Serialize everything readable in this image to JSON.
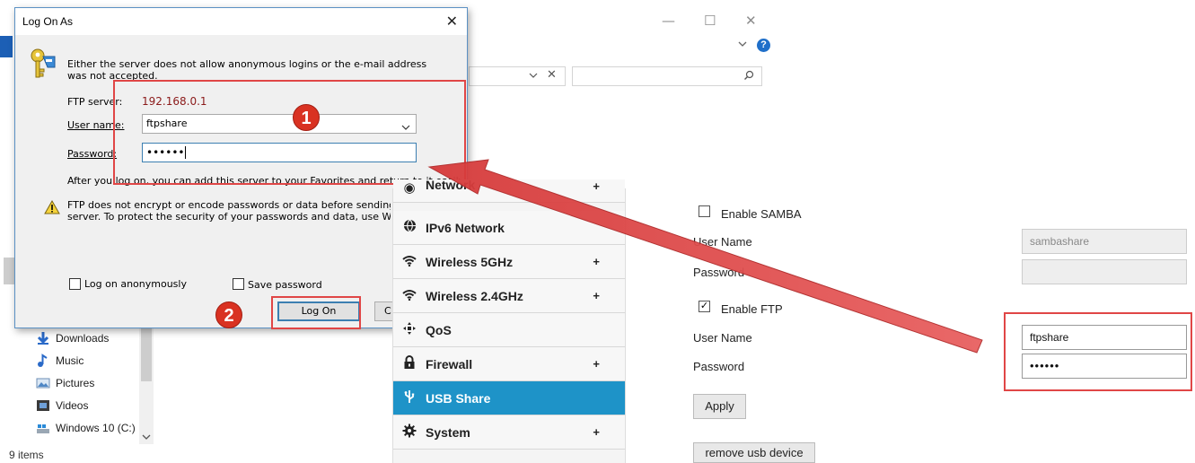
{
  "explorer": {
    "minimize_glyph": "—",
    "maximize_glyph": "☐",
    "close_glyph": "✕",
    "help_glyph": "?",
    "nav": [
      {
        "label": "Downloads",
        "icon": "download-arrow-icon"
      },
      {
        "label": "Music",
        "icon": "music-note-icon"
      },
      {
        "label": "Pictures",
        "icon": "pictures-icon"
      },
      {
        "label": "Videos",
        "icon": "videos-icon"
      },
      {
        "label": "Windows 10 (C:)",
        "icon": "drive-icon"
      }
    ],
    "status": "9 items"
  },
  "dialog": {
    "title": "Log On As",
    "message": "Either the server does not allow anonymous logins or the e-mail address was not accepted.",
    "ftp_server_label": "FTP server:",
    "ftp_server_value": "192.168.0.1",
    "username_label": "User name:",
    "username_value": "ftpshare",
    "password_label": "Password:",
    "password_value": "••••••",
    "favorites_note": "After you log on, you can add this server to your Favorites and return to it easily.",
    "warning_line1": "FTP does not encrypt or encode passwords or data before sending the",
    "warning_line2": "server.  To protect the security of your passwords and data, use Web",
    "anonymous_label": "Log on anonymously",
    "save_password_label": "Save password",
    "logon_button": "Log On",
    "cancel_button_partial": "C",
    "accent_color": "#3c7fb1",
    "server_value_color": "#8b1a1a"
  },
  "annotations": {
    "badge1": "1",
    "badge2": "2",
    "highlight_color": "#e04646"
  },
  "router_menu": {
    "items": [
      {
        "label": "Network",
        "icon": "globe-icon",
        "expandable": true
      },
      {
        "label": "IPv6 Network",
        "icon": "globe-icon",
        "expandable": false
      },
      {
        "label": "Wireless 5GHz",
        "icon": "wifi-icon",
        "expandable": true
      },
      {
        "label": "Wireless 2.4GHz",
        "icon": "wifi-icon",
        "expandable": true
      },
      {
        "label": "QoS",
        "icon": "qos-icon",
        "expandable": false
      },
      {
        "label": "Firewall",
        "icon": "lock-icon",
        "expandable": true
      },
      {
        "label": "USB Share",
        "icon": "usb-icon",
        "expandable": false,
        "active": true
      },
      {
        "label": "System",
        "icon": "gear-icon",
        "expandable": true
      }
    ],
    "plus": "+",
    "active_color": "#1e93c8"
  },
  "usb_form": {
    "samba": {
      "label": "Enable SAMBA",
      "checked": false,
      "username_label": "User Name",
      "username_value": "sambashare",
      "password_label": "Password",
      "password_value": ""
    },
    "ftp": {
      "label": "Enable FTP",
      "checked": true,
      "check_glyph": "✓",
      "username_label": "User Name",
      "username_value": "ftpshare",
      "password_label": "Password",
      "password_value": "••••••"
    },
    "apply_button": "Apply",
    "remove_button": "remove usb device"
  }
}
